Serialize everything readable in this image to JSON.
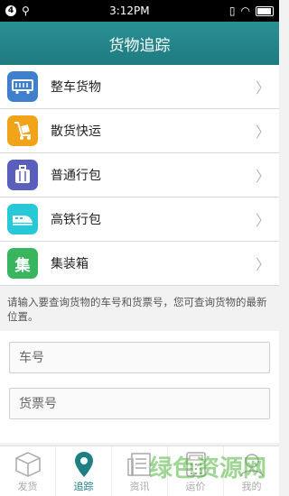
{
  "status_bar": {
    "badge": "4",
    "time": "3:12PM"
  },
  "header": {
    "title": "货物追踪"
  },
  "menu": [
    {
      "label": "整车货物",
      "icon": "train-car-icon",
      "color": "#3f7fce"
    },
    {
      "label": "散货快运",
      "icon": "hand-truck-icon",
      "color": "#f1a31a"
    },
    {
      "label": "普通行包",
      "icon": "luggage-icon",
      "color": "#5a5fbe"
    },
    {
      "label": "高铁行包",
      "icon": "bullet-train-icon",
      "color": "#28c8d6"
    },
    {
      "label": "集装箱",
      "icon": "container-icon",
      "color": "#39b55e"
    }
  ],
  "hint": "请输入要查询货物的车号和货票号，您可查询货物的最新位置。",
  "form": {
    "car_number_placeholder": "车号",
    "ticket_number_placeholder": "货票号"
  },
  "bottom_nav": [
    {
      "label": "发货",
      "icon": "box-icon"
    },
    {
      "label": "追踪",
      "icon": "location-pin-icon",
      "active": true
    },
    {
      "label": "资讯",
      "icon": "news-icon"
    },
    {
      "label": "运价",
      "icon": "calculator-icon"
    },
    {
      "label": "我的",
      "icon": "user-icon"
    }
  ],
  "watermark": "绿色资源网",
  "colors": {
    "header": "#1e7b80",
    "active_tab": "#1f7f84"
  }
}
